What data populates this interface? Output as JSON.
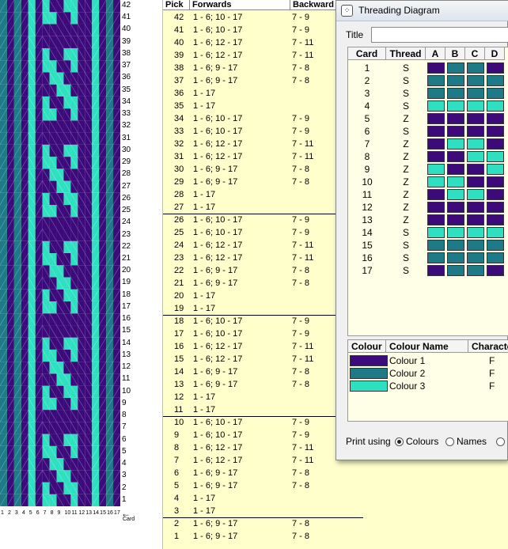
{
  "pattern": {
    "card_labels": [
      "1",
      "2",
      "3",
      "4",
      "5",
      "6",
      "7",
      "8",
      "9",
      "10",
      "11",
      "12",
      "13",
      "14",
      "15",
      "16",
      "17"
    ],
    "axis_label": "Card"
  },
  "sheet": {
    "headers": {
      "pick": "Pick",
      "forwards": "Forwards",
      "backwards": "Backward"
    },
    "rows": [
      {
        "pick": "42",
        "fwd": "1 - 6; 10 - 17",
        "bwd": "7 - 9"
      },
      {
        "pick": "41",
        "fwd": "1 - 6; 10 - 17",
        "bwd": "7 - 9"
      },
      {
        "pick": "40",
        "fwd": "1 - 6; 12 - 17",
        "bwd": "7 - 11"
      },
      {
        "pick": "39",
        "fwd": "1 - 6; 12 - 17",
        "bwd": "7 - 11"
      },
      {
        "pick": "38",
        "fwd": "1 - 6; 9 - 17",
        "bwd": "7 - 8"
      },
      {
        "pick": "37",
        "fwd": "1 - 6; 9 - 17",
        "bwd": "7 - 8"
      },
      {
        "pick": "36",
        "fwd": "1 - 17",
        "bwd": ""
      },
      {
        "pick": "35",
        "fwd": "1 - 17",
        "bwd": ""
      },
      {
        "pick": "34",
        "fwd": "1 - 6; 10 - 17",
        "bwd": "7 - 9"
      },
      {
        "pick": "33",
        "fwd": "1 - 6; 10 - 17",
        "bwd": "7 - 9"
      },
      {
        "pick": "32",
        "fwd": "1 - 6; 12 - 17",
        "bwd": "7 - 11"
      },
      {
        "pick": "31",
        "fwd": "1 - 6; 12 - 17",
        "bwd": "7 - 11"
      },
      {
        "pick": "30",
        "fwd": "1 - 6; 9 - 17",
        "bwd": "7 - 8"
      },
      {
        "pick": "29",
        "fwd": "1 - 6; 9 - 17",
        "bwd": "7 - 8"
      },
      {
        "pick": "28",
        "fwd": "1 - 17",
        "bwd": ""
      },
      {
        "pick": "27",
        "fwd": "1 - 17",
        "bwd": ""
      },
      {
        "pick": "26",
        "fwd": "1 - 6; 10 - 17",
        "bwd": "7 - 9"
      },
      {
        "pick": "25",
        "fwd": "1 - 6; 10 - 17",
        "bwd": "7 - 9"
      },
      {
        "pick": "24",
        "fwd": "1 - 6; 12 - 17",
        "bwd": "7 - 11"
      },
      {
        "pick": "23",
        "fwd": "1 - 6; 12 - 17",
        "bwd": "7 - 11"
      },
      {
        "pick": "22",
        "fwd": "1 - 6; 9 - 17",
        "bwd": "7 - 8"
      },
      {
        "pick": "21",
        "fwd": "1 - 6; 9 - 17",
        "bwd": "7 - 8"
      },
      {
        "pick": "20",
        "fwd": "1 - 17",
        "bwd": ""
      },
      {
        "pick": "19",
        "fwd": "1 - 17",
        "bwd": ""
      },
      {
        "pick": "18",
        "fwd": "1 - 6; 10 - 17",
        "bwd": "7 - 9"
      },
      {
        "pick": "17",
        "fwd": "1 - 6; 10 - 17",
        "bwd": "7 - 9"
      },
      {
        "pick": "16",
        "fwd": "1 - 6; 12 - 17",
        "bwd": "7 - 11"
      },
      {
        "pick": "15",
        "fwd": "1 - 6; 12 - 17",
        "bwd": "7 - 11"
      },
      {
        "pick": "14",
        "fwd": "1 - 6; 9 - 17",
        "bwd": "7 - 8"
      },
      {
        "pick": "13",
        "fwd": "1 - 6; 9 - 17",
        "bwd": "7 - 8"
      },
      {
        "pick": "12",
        "fwd": "1 - 17",
        "bwd": ""
      },
      {
        "pick": "11",
        "fwd": "1 - 17",
        "bwd": ""
      },
      {
        "pick": "10",
        "fwd": "1 - 6; 10 - 17",
        "bwd": "7 - 9"
      },
      {
        "pick": "9",
        "fwd": "1 - 6; 10 - 17",
        "bwd": "7 - 9"
      },
      {
        "pick": "8",
        "fwd": "1 - 6; 12 - 17",
        "bwd": "7 - 11"
      },
      {
        "pick": "7",
        "fwd": "1 - 6; 12 - 17",
        "bwd": "7 - 11"
      },
      {
        "pick": "6",
        "fwd": "1 - 6; 9 - 17",
        "bwd": "7 - 8"
      },
      {
        "pick": "5",
        "fwd": "1 - 6; 9 - 17",
        "bwd": "7 - 8"
      },
      {
        "pick": "4",
        "fwd": "1 - 17",
        "bwd": ""
      },
      {
        "pick": "3",
        "fwd": "1 - 17",
        "bwd": ""
      },
      {
        "pick": "2",
        "fwd": "1 - 6; 9 - 17",
        "bwd": "7 - 8"
      },
      {
        "pick": "1",
        "fwd": "1 - 6; 9 - 17",
        "bwd": "7 - 8"
      }
    ]
  },
  "dialog": {
    "title": "Threading Diagram",
    "title_label": "Title",
    "title_value": "",
    "table_headers": {
      "card": "Card",
      "thread": "Thread",
      "a": "A",
      "b": "B",
      "c": "C",
      "d": "D"
    },
    "cards": [
      {
        "card": "1",
        "thread": "S",
        "holes": [
          1,
          2,
          2,
          1
        ]
      },
      {
        "card": "2",
        "thread": "S",
        "holes": [
          2,
          2,
          2,
          2
        ]
      },
      {
        "card": "3",
        "thread": "S",
        "holes": [
          2,
          2,
          2,
          2
        ]
      },
      {
        "card": "4",
        "thread": "S",
        "holes": [
          3,
          3,
          3,
          3
        ]
      },
      {
        "card": "5",
        "thread": "Z",
        "holes": [
          1,
          1,
          1,
          1
        ]
      },
      {
        "card": "6",
        "thread": "S",
        "holes": [
          1,
          1,
          1,
          1
        ]
      },
      {
        "card": "7",
        "thread": "Z",
        "holes": [
          1,
          3,
          3,
          1
        ]
      },
      {
        "card": "8",
        "thread": "Z",
        "holes": [
          1,
          1,
          3,
          3
        ]
      },
      {
        "card": "9",
        "thread": "Z",
        "holes": [
          3,
          1,
          1,
          3
        ]
      },
      {
        "card": "10",
        "thread": "Z",
        "holes": [
          3,
          3,
          1,
          1
        ]
      },
      {
        "card": "11",
        "thread": "Z",
        "holes": [
          1,
          3,
          3,
          1
        ]
      },
      {
        "card": "12",
        "thread": "Z",
        "holes": [
          1,
          1,
          1,
          1
        ]
      },
      {
        "card": "13",
        "thread": "Z",
        "holes": [
          1,
          1,
          1,
          1
        ]
      },
      {
        "card": "14",
        "thread": "S",
        "holes": [
          3,
          3,
          3,
          3
        ]
      },
      {
        "card": "15",
        "thread": "S",
        "holes": [
          2,
          2,
          2,
          2
        ]
      },
      {
        "card": "16",
        "thread": "S",
        "holes": [
          2,
          2,
          2,
          2
        ]
      },
      {
        "card": "17",
        "thread": "S",
        "holes": [
          1,
          2,
          2,
          1
        ]
      }
    ],
    "colour_headers": {
      "colour": "Colour",
      "name": "Colour Name",
      "character": "Characte"
    },
    "colours": [
      {
        "hex": "#3c0a7a",
        "name": "Colour 1",
        "character": "F"
      },
      {
        "hex": "#1e7a86",
        "name": "Colour 2",
        "character": "F"
      },
      {
        "hex": "#2ee0c0",
        "name": "Colour 3",
        "character": "F"
      }
    ],
    "print_label": "Print using",
    "print_options": [
      "Colours",
      "Names",
      ""
    ],
    "print_selected": "Colours"
  },
  "colors": {
    "purple": "#3c0a7a",
    "teal": "#1e7a86",
    "mint": "#2ee0c0",
    "sheet_bg": "#ffffcc"
  }
}
